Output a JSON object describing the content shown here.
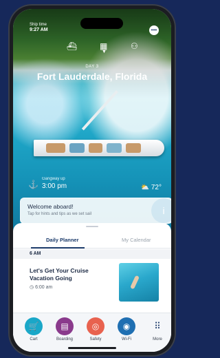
{
  "status": {
    "carrier": "Ship time",
    "time": "9:27 AM"
  },
  "header": {
    "icons": [
      "ship-icon",
      "calendar-icon",
      "profile-icon"
    ],
    "day_label": "DAY 3",
    "port": "Fort Lauderdale, Florida"
  },
  "info": {
    "gangway_label": "Gangway up",
    "gangway_time": "3:00 pm",
    "weather_temp": "72°"
  },
  "welcome": {
    "title": "Welcome aboard!",
    "subtitle": "Tap for hints and tips as we set sail"
  },
  "planner": {
    "tabs": [
      "Daily Planner",
      "My Calendar"
    ],
    "time_band": "6 AM",
    "event": {
      "title": "Let's Get Your Cruise Vacation Going",
      "time": "6:00 am"
    }
  },
  "tabbar": [
    {
      "label": "Cart",
      "icon": "cart-icon",
      "color": "#1aa7c8"
    },
    {
      "label": "Boarding",
      "icon": "boarding-pass-icon",
      "color": "#8a3a8c"
    },
    {
      "label": "Safety",
      "icon": "life-ring-icon",
      "color": "#e8624f"
    },
    {
      "label": "Wi-Fi",
      "icon": "wifi-icon",
      "color": "#1f6fb2"
    },
    {
      "label": "More",
      "icon": "grid-icon",
      "color": "#1b3a6a"
    }
  ]
}
